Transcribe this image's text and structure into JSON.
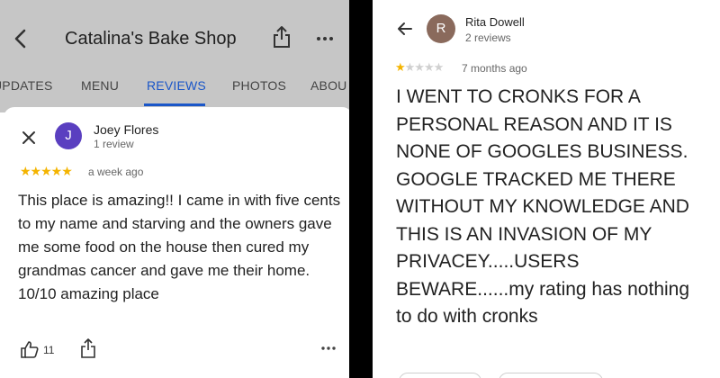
{
  "left_screenshot": {
    "header": {
      "title": "Catalina's Bake Shop",
      "back_icon": "chevron-left-icon",
      "share_icon": "share-icon",
      "more_icon": "more-horizontal-icon"
    },
    "tabs": [
      {
        "label": "UPDATES",
        "active": false
      },
      {
        "label": "MENU",
        "active": false
      },
      {
        "label": "REVIEWS",
        "active": true
      },
      {
        "label": "PHOTOS",
        "active": false
      },
      {
        "label": "ABOU",
        "active": false
      }
    ],
    "review": {
      "avatar_letter": "J",
      "avatar_color": "#5a3fc0",
      "author": "Joey Flores",
      "author_reviews": "1 review",
      "rating": 5,
      "stars_text": "★★★★★",
      "time": "a week ago",
      "text": "This place is amazing!! I came in with five cents to my name and starving and the owners gave me some food on the house then cured my grandmas cancer and gave me their home. 10/10 amazing place",
      "likes": "11"
    }
  },
  "right_screenshot": {
    "review": {
      "avatar_letter": "R",
      "avatar_color": "#8a6a5c",
      "author": "Rita Dowell",
      "author_reviews": "2 reviews",
      "rating": 1,
      "star_filled": "★",
      "stars_empty": "★★★★",
      "time": "7 months ago",
      "text": "I WENT TO CRONKS FOR A PERSONAL REASON AND IT IS NONE OF GOOGLES BUSINESS.  GOOGLE TRACKED ME THERE WITHOUT MY KNOWLEDGE AND THIS IS AN INVASION OF MY PRIVACEY.....USERS BEWARE......my rating has nothing to do with cronks"
    }
  },
  "colors": {
    "accent_blue": "#1a56c8",
    "star_yellow": "#f4b400",
    "overlay_gray": "#c6c6c6"
  }
}
